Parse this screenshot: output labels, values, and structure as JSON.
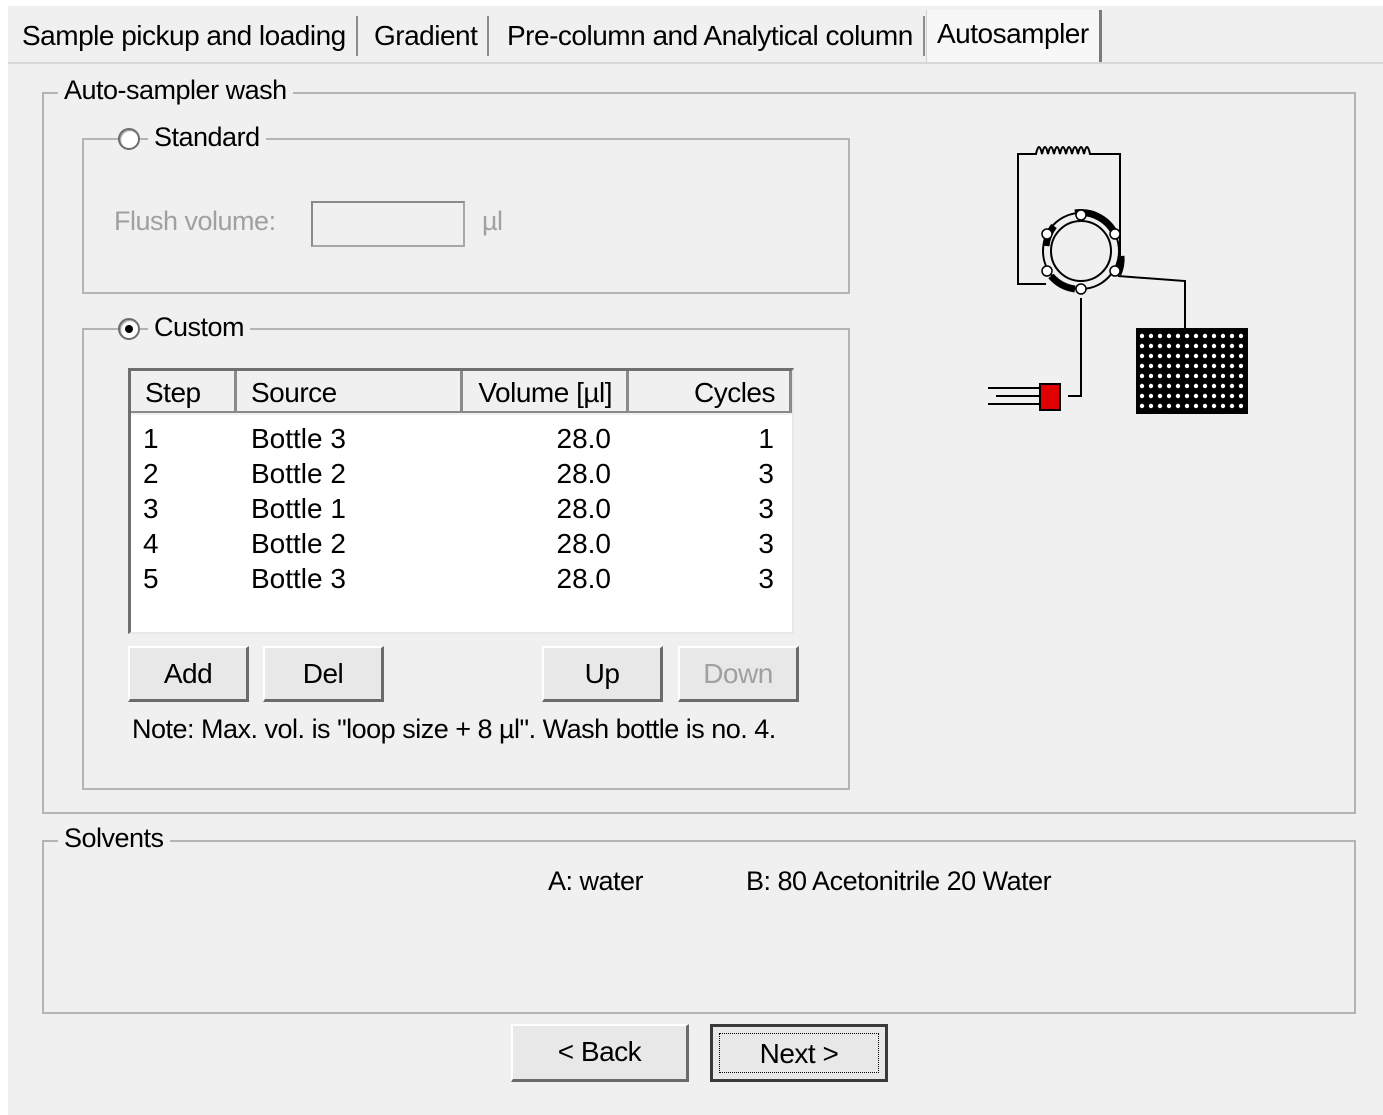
{
  "tabs": [
    {
      "label": "Sample pickup and loading",
      "active": false
    },
    {
      "label": "Gradient",
      "active": false
    },
    {
      "label": "Pre-column and Analytical column",
      "active": false
    },
    {
      "label": "Autosampler",
      "active": true
    }
  ],
  "wash": {
    "group_title": "Auto-sampler wash",
    "standard": {
      "label": "Standard",
      "selected": false,
      "flush_label": "Flush volume:",
      "flush_value": "",
      "flush_unit": "µl"
    },
    "custom": {
      "label": "Custom",
      "selected": true,
      "columns": [
        "Step",
        "Source",
        "Volume [µl]",
        "Cycles"
      ],
      "rows": [
        {
          "step": "1",
          "source": "Bottle 3",
          "volume": "28.0",
          "cycles": "1"
        },
        {
          "step": "2",
          "source": "Bottle 2",
          "volume": "28.0",
          "cycles": "3"
        },
        {
          "step": "3",
          "source": "Bottle 1",
          "volume": "28.0",
          "cycles": "3"
        },
        {
          "step": "4",
          "source": "Bottle 2",
          "volume": "28.0",
          "cycles": "3"
        },
        {
          "step": "5",
          "source": "Bottle 3",
          "volume": "28.0",
          "cycles": "3"
        }
      ],
      "buttons": {
        "add": "Add",
        "del": "Del",
        "up": "Up",
        "down": "Down"
      },
      "note": "Note: Max. vol. is \"loop size + 8 µl\".  Wash bottle is no. 4."
    }
  },
  "solvents": {
    "group_title": "Solvents",
    "a": "A: water",
    "b": "B: 80 Acetonitrile 20 Water"
  },
  "nav": {
    "back": "< Back",
    "next": "Next >"
  },
  "colors": {
    "syringe": "#e00000",
    "dialog_bg": "#f0f0f0"
  }
}
